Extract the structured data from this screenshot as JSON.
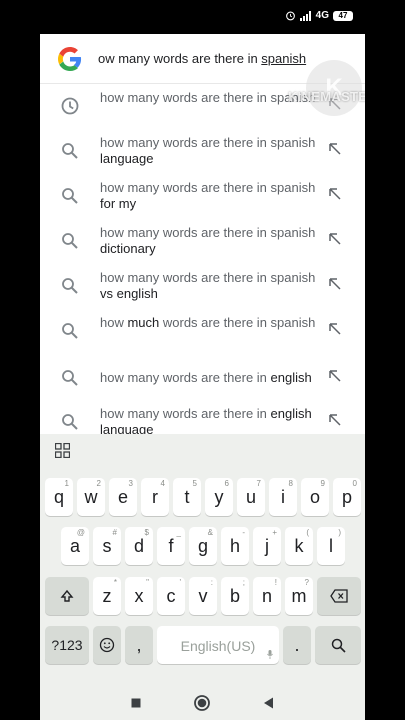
{
  "status_bar": {
    "network": "4G",
    "battery": "47"
  },
  "watermark": {
    "text": "KINEMASTER",
    "badge": "K"
  },
  "search": {
    "query_prefix": "ow many words are there in ",
    "query_underlined": "spanish"
  },
  "suggestions": [
    {
      "icon": "history-icon",
      "plain": "how many words are there in spanish",
      "bold": ""
    },
    {
      "icon": "search-icon",
      "plain": "how many words are there in spanish ",
      "bold": "language"
    },
    {
      "icon": "search-icon",
      "plain": "how many words are there in spanish ",
      "bold": "for my"
    },
    {
      "icon": "search-icon",
      "plain": "how many words are there in spanish ",
      "bold": "dictionary"
    },
    {
      "icon": "search-icon",
      "plain": "how many words are there in spanish ",
      "bold": "vs english"
    },
    {
      "icon": "search-icon",
      "plain": "how ",
      "bold": "much",
      "rest": " words are there in spanish"
    },
    {
      "icon": "search-icon",
      "plain": "how many words are there in ",
      "bold": "english"
    },
    {
      "icon": "search-icon",
      "plain": "how many words are there in ",
      "bold": "english language"
    }
  ],
  "keyboard": {
    "row1": [
      {
        "k": "q",
        "h": "1"
      },
      {
        "k": "w",
        "h": "2"
      },
      {
        "k": "e",
        "h": "3"
      },
      {
        "k": "r",
        "h": "4"
      },
      {
        "k": "t",
        "h": "5"
      },
      {
        "k": "y",
        "h": "6"
      },
      {
        "k": "u",
        "h": "7"
      },
      {
        "k": "i",
        "h": "8"
      },
      {
        "k": "o",
        "h": "9"
      },
      {
        "k": "p",
        "h": "0"
      }
    ],
    "row2": [
      {
        "k": "a",
        "h": "@"
      },
      {
        "k": "s",
        "h": "#"
      },
      {
        "k": "d",
        "h": "$"
      },
      {
        "k": "f",
        "h": "_"
      },
      {
        "k": "g",
        "h": "&"
      },
      {
        "k": "h",
        "h": "-"
      },
      {
        "k": "j",
        "h": "+"
      },
      {
        "k": "k",
        "h": "("
      },
      {
        "k": "l",
        "h": ")"
      }
    ],
    "row3": [
      {
        "k": "z",
        "h": "*"
      },
      {
        "k": "x",
        "h": "\""
      },
      {
        "k": "c",
        "h": "'"
      },
      {
        "k": "v",
        "h": ":"
      },
      {
        "k": "b",
        "h": ";"
      },
      {
        "k": "n",
        "h": "!"
      },
      {
        "k": "m",
        "h": "?"
      }
    ],
    "symbols_label": "?123",
    "comma_label": ",",
    "space_label": "English(US)",
    "period_label": "."
  }
}
